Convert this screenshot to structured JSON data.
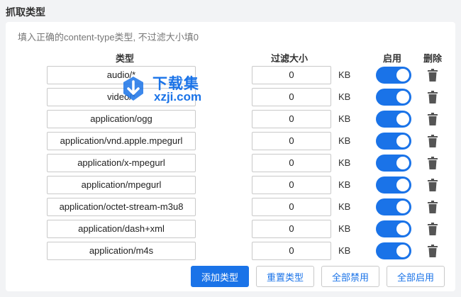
{
  "section_title": "抓取类型",
  "hint": "填入正确的content-type类型, 不过滤大小填0",
  "headers": {
    "type": "类型",
    "size": "过滤大小",
    "enable": "启用",
    "delete": "删除"
  },
  "unit": "KB",
  "rows": [
    {
      "type": "audio/*",
      "size": "0",
      "enabled": true
    },
    {
      "type": "video/*",
      "size": "0",
      "enabled": true
    },
    {
      "type": "application/ogg",
      "size": "0",
      "enabled": true
    },
    {
      "type": "application/vnd.apple.mpegurl",
      "size": "0",
      "enabled": true
    },
    {
      "type": "application/x-mpegurl",
      "size": "0",
      "enabled": true
    },
    {
      "type": "application/mpegurl",
      "size": "0",
      "enabled": true
    },
    {
      "type": "application/octet-stream-m3u8",
      "size": "0",
      "enabled": true
    },
    {
      "type": "application/dash+xml",
      "size": "0",
      "enabled": true
    },
    {
      "type": "application/m4s",
      "size": "0",
      "enabled": true
    }
  ],
  "buttons": {
    "add": "添加类型",
    "reset": "重置类型",
    "disable_all": "全部禁用",
    "enable_all": "全部启用"
  },
  "watermark": {
    "title": "下载集",
    "url": "xzji.com"
  },
  "colors": {
    "accent": "#1a73e8",
    "icon_gray": "#555555"
  }
}
